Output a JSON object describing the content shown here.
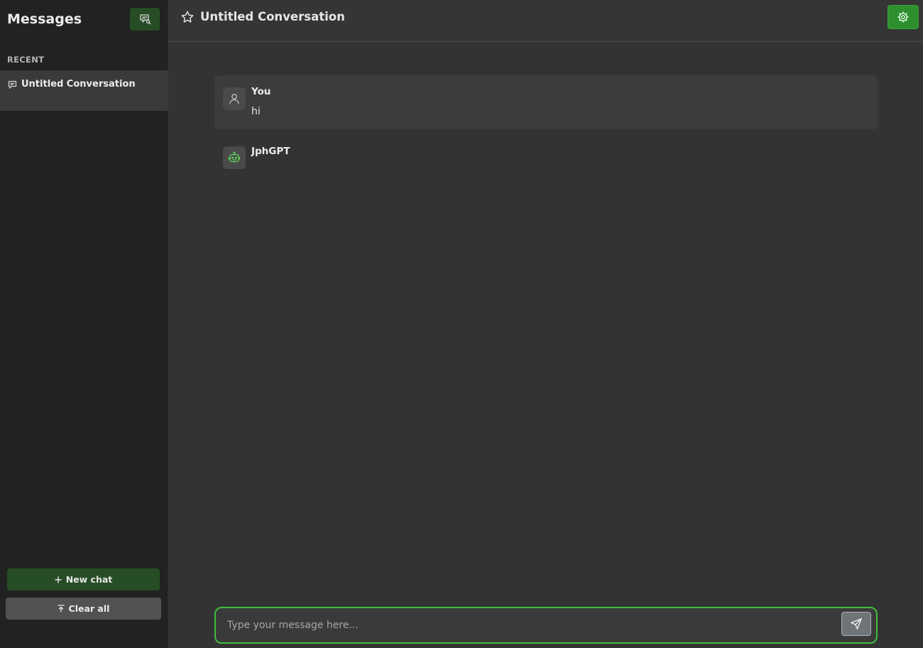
{
  "sidebar": {
    "title": "Messages",
    "search_icon": "chat-search-icon",
    "section_label": "RECENT",
    "conversations": [
      {
        "label": "Untitled Conversation",
        "icon": "chat-bubble-icon"
      }
    ],
    "new_chat_label": "New chat",
    "clear_all_label": "Clear all"
  },
  "header": {
    "title": "Untitled Conversation",
    "star_icon": "star-icon",
    "settings_icon": "gear-icon"
  },
  "messages": [
    {
      "author": "You",
      "text": "hi",
      "avatar_icon": "user-icon"
    },
    {
      "author": "JphGPT",
      "text": "",
      "avatar_icon": "robot-icon"
    }
  ],
  "composer": {
    "placeholder": "Type your message here...",
    "value": "",
    "send_icon": "send-icon"
  },
  "colors": {
    "accent_green": "#264d26",
    "settings_green": "#2e8f2e",
    "input_border": "#3fbf3f",
    "bot_icon": "#5fd35f"
  }
}
